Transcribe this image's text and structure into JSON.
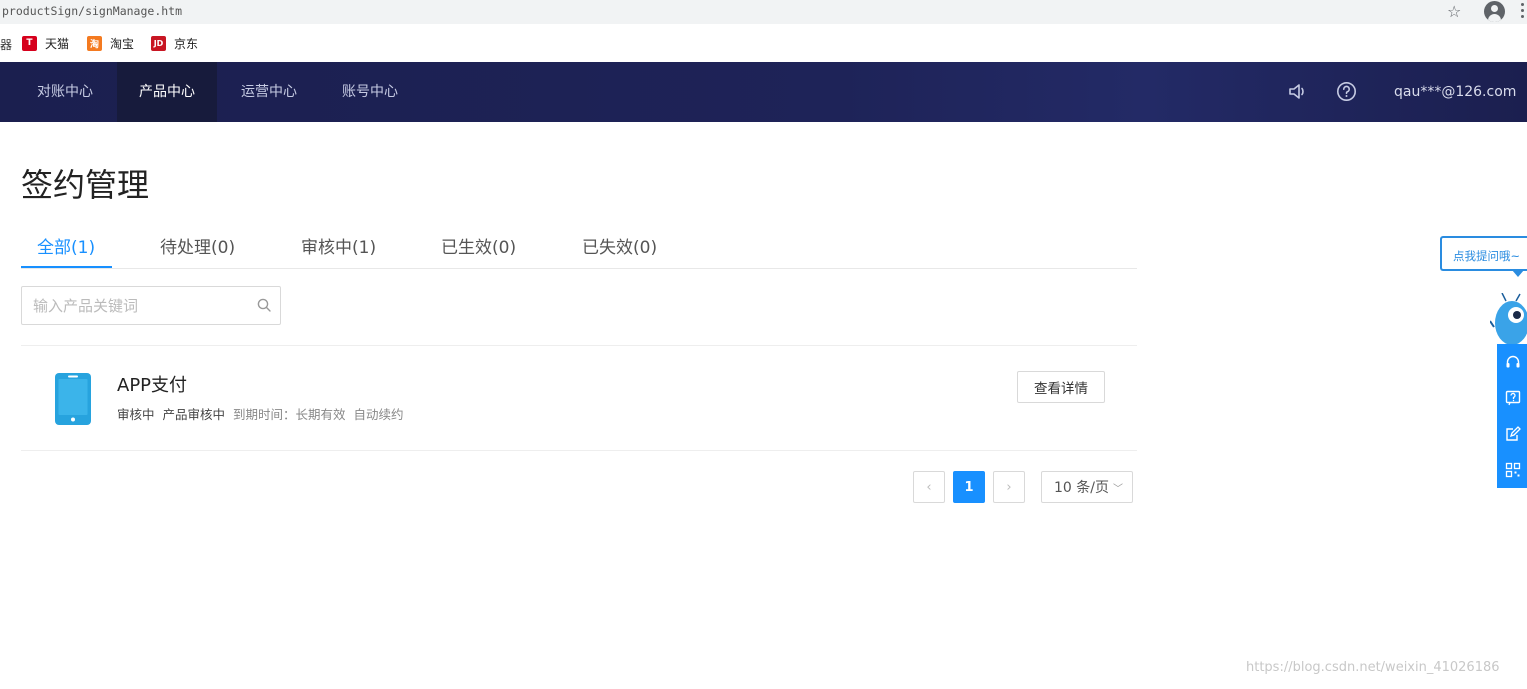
{
  "browser": {
    "address": "productSign/signManage.htm",
    "bookmarks_edge": "器",
    "bookmarks": [
      {
        "label": "天猫",
        "icon": "tmall-icon",
        "icon_text": "T",
        "color": "#d6001c"
      },
      {
        "label": "淘宝",
        "icon": "taobao-icon",
        "icon_text": "淘",
        "color": "#f47a20"
      },
      {
        "label": "京东",
        "icon": "jd-icon",
        "icon_text": "JD",
        "color": "#c81623"
      }
    ]
  },
  "nav": {
    "items": [
      {
        "label": "对账中心"
      },
      {
        "label": "产品中心",
        "active": true
      },
      {
        "label": "运营中心"
      },
      {
        "label": "账号中心"
      }
    ],
    "icons": [
      "speaker-icon",
      "help-icon"
    ],
    "user_email": "qau***@126.com"
  },
  "page": {
    "title": "签约管理",
    "tabs": [
      {
        "label": "全部(1)",
        "active": true
      },
      {
        "label": "待处理(0)"
      },
      {
        "label": "审核中(1)"
      },
      {
        "label": "已生效(0)"
      },
      {
        "label": "已失效(0)"
      }
    ],
    "search": {
      "placeholder": "输入产品关键词",
      "value": ""
    },
    "products": [
      {
        "icon": "phone-icon",
        "name": "APP支付",
        "status": "审核中",
        "sub_status": "产品审核中",
        "expiry": "到期时间：长期有效",
        "renew": "自动续约",
        "action_label": "查看详情"
      }
    ],
    "pagination": {
      "prev": "‹",
      "current": "1",
      "next": "›",
      "page_size": "10 条/页"
    }
  },
  "widget": {
    "bubble_text": "点我提问哦~",
    "icons": [
      "headset-icon",
      "question-icon",
      "edit-icon",
      "qrcode-icon"
    ],
    "accent": "#1890ff"
  },
  "watermark": "https://blog.csdn.net/weixin_41026186"
}
